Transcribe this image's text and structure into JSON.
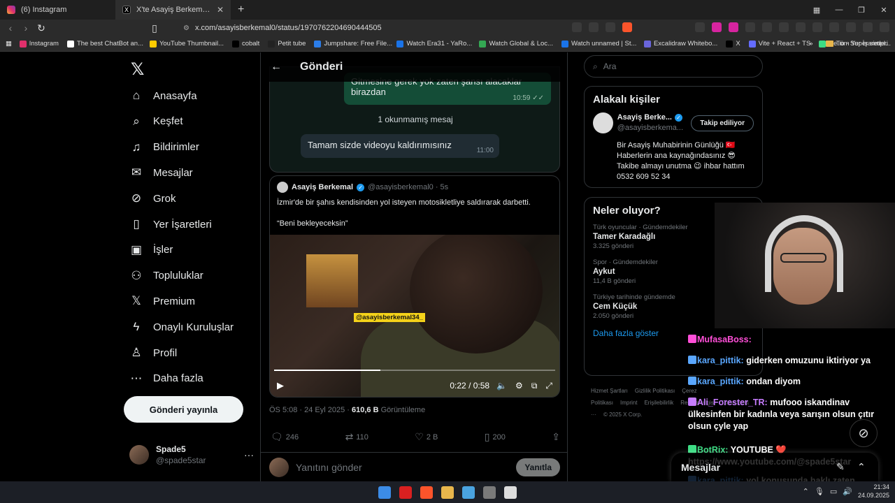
{
  "browser": {
    "tabs": [
      {
        "title": "(6) Instagram",
        "icon": "instagram-icon",
        "active": false
      },
      {
        "title": "X'te Asayiş Berkemal: \"Saldırı",
        "icon": "x-icon",
        "active": true
      }
    ],
    "newtab_glyph": "+",
    "url": "x.com/asayisberkemal0/status/1970762204690444505",
    "bookmarks": [
      {
        "label": "Instagram",
        "color": "#e1306c"
      },
      {
        "label": "The best ChatBot an...",
        "color": "#ffffff"
      },
      {
        "label": "YouTube Thumbnail...",
        "color": "#ffcc00"
      },
      {
        "label": "cobalt",
        "color": "#000000"
      },
      {
        "label": "Petit tube",
        "color": "#222222"
      },
      {
        "label": "Jumpshare: Free File...",
        "color": "#2b7de9"
      },
      {
        "label": "Watch Era31 - YaRo...",
        "color": "#1a73e8"
      },
      {
        "label": "Watch Global & Loc...",
        "color": "#34a853"
      },
      {
        "label": "Watch unnamed | St...",
        "color": "#1a73e8"
      },
      {
        "label": "Excalidraw Whitebo...",
        "color": "#6965db"
      },
      {
        "label": "X",
        "color": "#000000"
      },
      {
        "label": "Vite + React + TS",
        "color": "#646cff"
      },
      {
        "label": "file.io - Super simpl...",
        "color": "#3ddc84"
      }
    ],
    "bookmarks_overflow": "»",
    "all_bookmarks": "Tüm Yer İşaretleri"
  },
  "nav": {
    "items": [
      {
        "label": "Anasayfa",
        "icon": "home-icon",
        "glyph": "⌂"
      },
      {
        "label": "Keşfet",
        "icon": "search-icon",
        "glyph": "⌕"
      },
      {
        "label": "Bildirimler",
        "icon": "bell-icon",
        "glyph": "♫"
      },
      {
        "label": "Mesajlar",
        "icon": "mail-icon",
        "glyph": "✉"
      },
      {
        "label": "Grok",
        "icon": "grok-icon",
        "glyph": "⊘"
      },
      {
        "label": "Yer İşaretleri",
        "icon": "bookmark-icon",
        "glyph": "▯"
      },
      {
        "label": "İşler",
        "icon": "briefcase-icon",
        "glyph": "▣"
      },
      {
        "label": "Topluluklar",
        "icon": "people-icon",
        "glyph": "⚇"
      },
      {
        "label": "Premium",
        "icon": "x-premium-icon",
        "glyph": "𝕏"
      },
      {
        "label": "Onaylı Kuruluşlar",
        "icon": "lightning-icon",
        "glyph": "ϟ"
      },
      {
        "label": "Profil",
        "icon": "person-icon",
        "glyph": "♙"
      },
      {
        "label": "Daha fazla",
        "icon": "more-circle-icon",
        "glyph": "⋯"
      }
    ],
    "post_button": "Gönderi yayınla",
    "account": {
      "name": "Spade5",
      "handle": "@spade5star",
      "more": "···"
    }
  },
  "main": {
    "back_glyph": "←",
    "title": "Gönderi",
    "chat": {
      "out_text": "Gitmesine gerek yok zaten şansı alacaklar birazdan",
      "out_time": "10:59",
      "unread": "1 okunmamış mesaj",
      "in_text": "Tamam sizde videoyu kaldırımısınız",
      "in_time": "11:00"
    },
    "quote": {
      "name": "Asayiş Berkemal",
      "handle": "@asayisberkemal0 · 5s",
      "text1": "İzmir'de bir şahıs kendisinden yol isteyen motosikletliye saldırarak darbetti.",
      "text2": "“Beni bekleyeceksin”",
      "video_tag": "@asayisberkemal34_",
      "video_time": "0:22 / 0:58",
      "video_progress": 0.379
    },
    "meta": {
      "date": "ÖS 5:08 · 24 Eyl 2025 · ",
      "views": "610,6 B",
      "views_label": " Görüntüleme"
    },
    "actions": {
      "replies": "246",
      "reposts": "110",
      "likes": "2 B",
      "bookmarks": "200"
    },
    "reply_placeholder": "Yanıtını gönder",
    "reply_button": "Yanıtla"
  },
  "right": {
    "search_placeholder": "Ara",
    "related": {
      "title": "Alakalı kişiler",
      "name": "Asayiş Berke...",
      "handle": "@asayisberkema...",
      "follow": "Takip ediliyor",
      "bio": "Bir Asayiş Muhabirinin Günlüğü 🇹🇷 Haberlerin ana kaynağındasınız 😎 Takibe almayı unutma 😉 ihbar hattım 0532 609 52 34"
    },
    "trends": {
      "title": "Neler oluyor?",
      "items": [
        {
          "cat": "Türk oyuncular · Gündemdekiler",
          "name": "Tamer Karadağlı",
          "count": "3.325 gönderi"
        },
        {
          "cat": "Spor · Gündemdekiler",
          "name": "Aykut",
          "count": "11,4 B gönderi"
        },
        {
          "cat": "Türkiye tarihinde gündemde",
          "name": "Cem Küçük",
          "count": "2.050 gönderi"
        }
      ],
      "more": "Daha fazla göster"
    },
    "footer": [
      "Hizmet Şartları",
      "Gizlilik Politikası",
      "Çerez Politikası",
      "Imprint",
      "Erişilebilirlik",
      "Reklam bilgisi",
      "Daha fazla ···",
      "© 2025 X Corp."
    ]
  },
  "overlay": {
    "chat": [
      {
        "user": "MufasaBoss:",
        "text": "",
        "color": "#ff4fd8"
      },
      {
        "user": "kara_pittik:",
        "text": "giderken omuzunu iktiriyor ya",
        "color": "#5aa7ff"
      },
      {
        "user": "kara_pittik:",
        "text": "ondan diyom",
        "color": "#5aa7ff"
      },
      {
        "user": "Ali_Forester_TR:",
        "text": "mufooo iskandinav ülkesinfen bir kadınla veya sarışın olsun çıtır olsun çyle yap",
        "color": "#c77dff"
      },
      {
        "user": "BotRix:",
        "text": "YOUTUBE ❤️ https://www.youtube.com/@spade5star",
        "color": "#3ddc84"
      },
      {
        "user": "kara_pittik:",
        "text": "yol konusunda haklı zaten",
        "color": "#5aa7ff"
      }
    ],
    "messages_drawer": "Mesajlar"
  },
  "taskbar": {
    "time": "21:34",
    "date": "24.09.2025",
    "apps": [
      "#3c8ce7",
      "#d92020",
      "#fb542b",
      "#e8b64c",
      "#4aa3df",
      "#7a7a7a",
      "#dddddd"
    ]
  }
}
